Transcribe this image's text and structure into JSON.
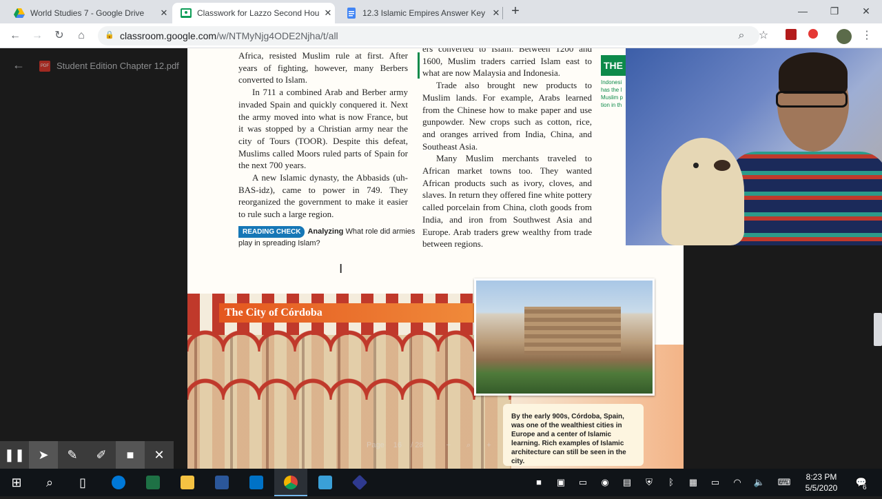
{
  "tabs": [
    {
      "title": "World Studies 7 - Google Drive",
      "icon": "google-drive-icon"
    },
    {
      "title": "Classwork for Lazzo Second Hou",
      "icon": "google-classroom-icon"
    },
    {
      "title": "12.3 Islamic Empires Answer Key",
      "icon": "google-docs-icon"
    }
  ],
  "address": {
    "url_host": "classroom.google.com",
    "url_path": "/w/NTMyNjg4ODE2Njha/t/all"
  },
  "viewer": {
    "file_name": "Student Edition Chapter 12.pdf"
  },
  "page": {
    "left_col": [
      "Africa, resisted Muslim rule at first. After years of fighting, however, many Berbers converted to Islam.",
      "In 711 a combined Arab and Berber army invaded Spain and quickly conquered it. Next the army moved into what is now France, but it was stopped by a Christian army near the city of Tours (TOOR). Despite this defeat, Muslims called Moors ruled parts of Spain for the next 700 years.",
      "A new Islamic dynasty, the Abbasids (uh-BAS-idz), came to power in 749. They reorganized the government to make it easier to rule such a large region."
    ],
    "reading_check_tag": "READING CHECK",
    "reading_check_bold": "Analyzing",
    "reading_check_text": "What role did armies play in spreading Islam?",
    "right_col": [
      "ers converted to Islam. Between 1200 and 1600, Muslim traders carried Islam east to what are now Malaysia and Indonesia.",
      "Trade also brought new products to Muslim lands. For example, Arabs learned from the Chinese how to make paper and use gunpowder. New crops such as cotton, rice, and oranges arrived from India, China, and Southeast Asia.",
      "Many Muslim merchants traveled to African market towns too. They wanted African products such as ivory, cloves, and slaves. In return they offered fine white pottery called porcelain from China, cloth goods from India, and iron from Southwest Asia and Europe. Arab traders grew wealthy from trade between regions."
    ],
    "impact_title": "THE IMPA TODA",
    "impact_text": "Indonesi has the l Muslim p tion in th",
    "cordoba_title": "The City of Córdoba",
    "caption": "By the early 900s, Córdoba, Spain, was one of the wealthiest cities in Europe and a center of Islamic learning. Rich examples of Islamic architecture can still be seen in the city.",
    "page_label": "Page",
    "page_num": "16",
    "page_total": "/ 28"
  },
  "taskbar": {
    "time": "8:23 PM",
    "date": "5/5/2020",
    "notifications": "6"
  }
}
